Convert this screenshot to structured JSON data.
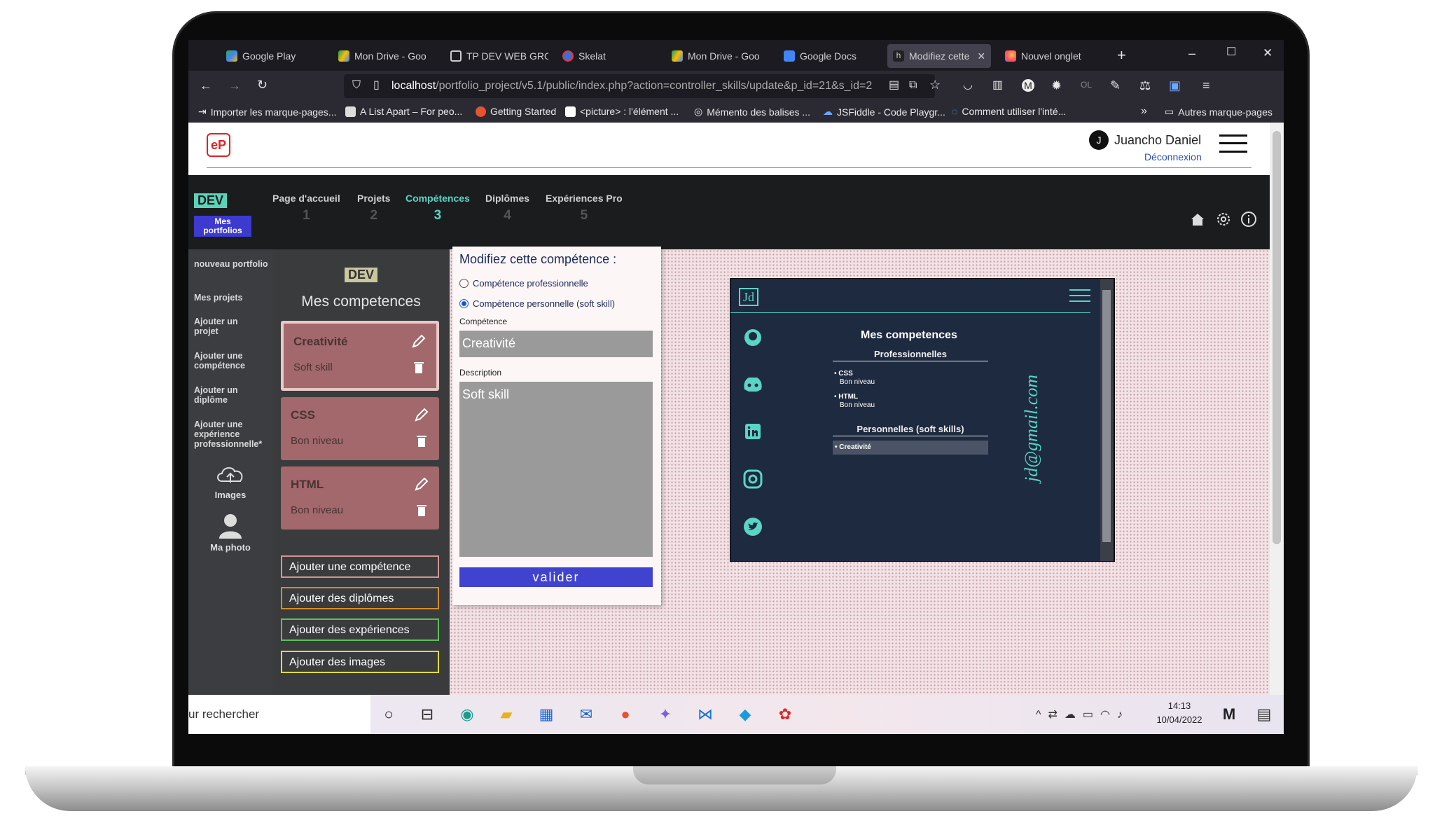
{
  "browser": {
    "tabs": [
      {
        "label": "Google Play",
        "active": false
      },
      {
        "label": "Mon Drive - Goo",
        "active": false
      },
      {
        "label": "TP DEV WEB GRO",
        "active": false
      },
      {
        "label": "Skelat",
        "active": false
      },
      {
        "label": "Mon Drive - Goo",
        "active": false
      },
      {
        "label": "Google Docs",
        "active": false
      },
      {
        "label": "Modifiez cette",
        "active": true
      },
      {
        "label": "Nouvel onglet",
        "active": false
      }
    ],
    "url_host": "localhost",
    "url_path": "/portfolio_project/v5.1/public/index.php?action=controller_skills/update&p_id=21&s_id=2",
    "bookmarks": [
      "Importer les marque-pages...",
      "A List Apart – For peo...",
      "Getting Started",
      "<picture> : l'élément ...",
      "Mémento des balises ...",
      "JSFiddle - Code Playgr...",
      "Comment utiliser l'inté..."
    ],
    "other_bookmarks": "Autres marque-pages"
  },
  "header": {
    "logo": "eP",
    "user_initial": "J",
    "user_name": "Juancho Daniel",
    "logout": "Déconnexion"
  },
  "nav": {
    "badge": "DEV",
    "my_portfolios": "Mes portfolios",
    "steps": [
      {
        "label": "Page d'accueil",
        "num": "1"
      },
      {
        "label": "Projets",
        "num": "2"
      },
      {
        "label": "Compétences",
        "num": "3"
      },
      {
        "label": "Diplômes",
        "num": "4"
      },
      {
        "label": "Expériences Pro",
        "num": "5"
      }
    ]
  },
  "sidebar": {
    "items": [
      "nouveau portfolio",
      "Mes projets",
      "Ajouter un projet",
      "Ajouter une compétence",
      "Ajouter un diplôme",
      "Ajouter une expérience professionnelle*"
    ],
    "images": "Images",
    "photo": "Ma photo"
  },
  "skills": {
    "badge": "DEV",
    "title": "Mes competences",
    "cards": [
      {
        "title": "Creativité",
        "desc": "Soft skill"
      },
      {
        "title": "CSS",
        "desc": "Bon niveau"
      },
      {
        "title": "HTML",
        "desc": "Bon niveau"
      }
    ],
    "buttons": [
      "Ajouter une compétence",
      "Ajouter des diplômes",
      "Ajouter des expériences",
      "Ajouter des images"
    ]
  },
  "form": {
    "title": "Modifiez cette compétence :",
    "radio1": "Compétence professionnelle",
    "radio2": "Compétence personnelle (soft skill)",
    "label_skill": "Compétence",
    "value_skill": "Creativité",
    "label_desc": "Description",
    "value_desc": "Soft skill",
    "submit": "valider"
  },
  "preview": {
    "logo": "Jd",
    "title": "Mes competences",
    "pro_heading": "Professionnelles",
    "pro_items": [
      {
        "name": "CSS",
        "level": "Bon niveau"
      },
      {
        "name": "HTML",
        "level": "Bon niveau"
      }
    ],
    "soft_heading": "Personnelles (soft skills)",
    "soft_items": [
      "Creativité"
    ],
    "email": "jd@gmail.com"
  },
  "taskbar": {
    "search": "ur rechercher",
    "time": "14:13",
    "date": "10/04/2022"
  }
}
